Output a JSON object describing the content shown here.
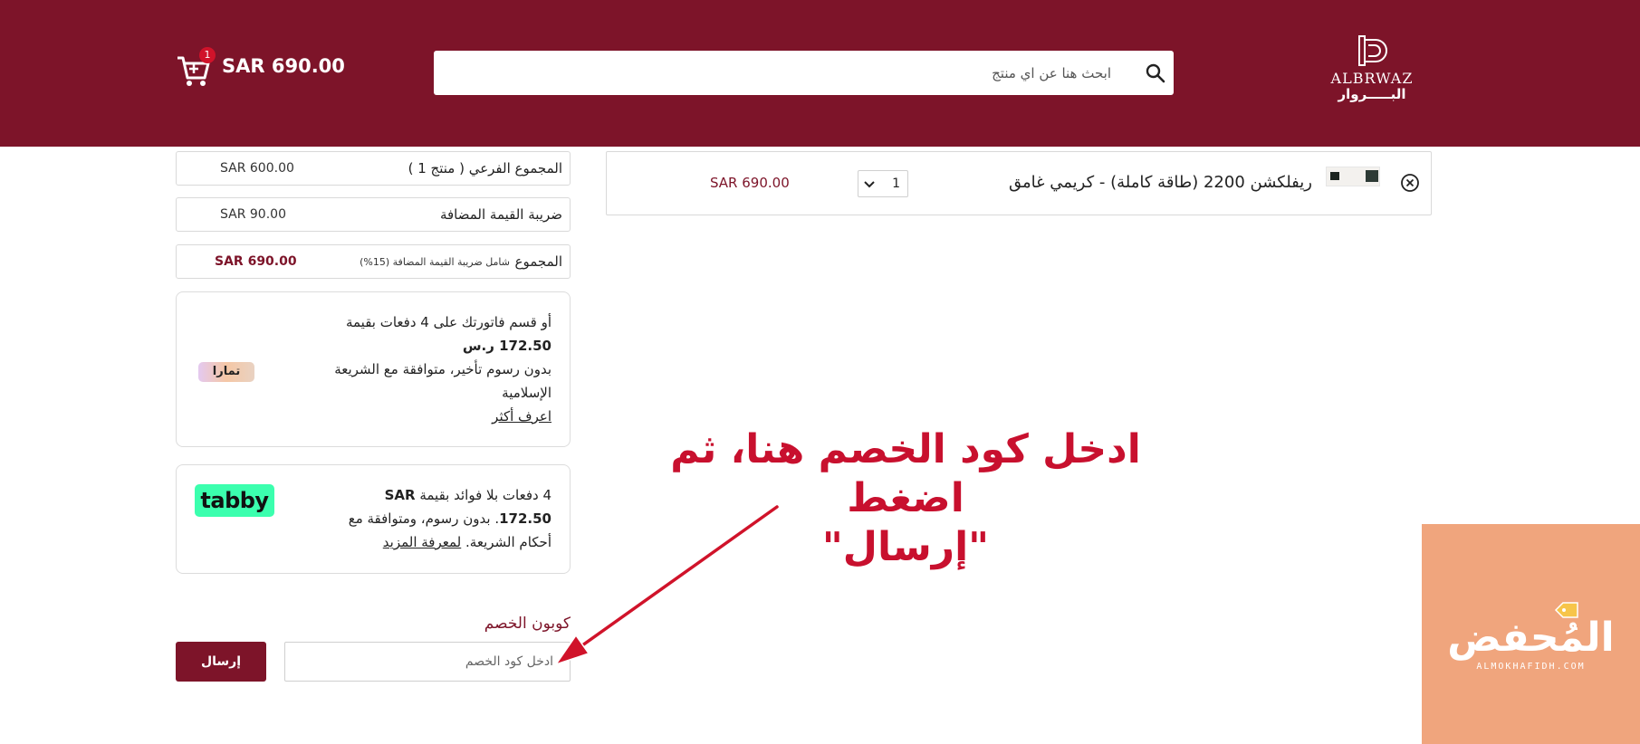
{
  "colors": {
    "brand": "#7d1429",
    "accent_red": "#c8102e",
    "tabby_green": "#3bffae",
    "watermark_bg": "#f0a57d"
  },
  "header": {
    "logo_en": "ALBRWAZ",
    "logo_ar": "البـــــروار",
    "search_placeholder": "ابحث هنا عن اي منتج",
    "cart_total": "SAR 690.00",
    "cart_count": "1",
    "icons": [
      "search-icon",
      "cart-icon"
    ]
  },
  "summary": {
    "subtotal_label": "المجموع الفرعي ( منتج 1 )",
    "subtotal_value": "SAR 600.00",
    "vat_label": "ضريبة القيمة المضافة",
    "vat_value": "SAR 90.00",
    "total_label": "المجموع",
    "total_note": "شامل ضريبة القيمة المضافة (15%)",
    "total_value": "SAR 690.00"
  },
  "tamara": {
    "line1": "أو قسم فاتورتك على 4 دفعات بقيمة",
    "amount": "172.50 ر.س",
    "line2": "بدون رسوم تأخير، متوافقة مع الشريعة الإسلامية",
    "learn_more": "اعرف أكثر",
    "logo": "تمارا"
  },
  "tabby": {
    "line1": "4 دفعات بلا فوائد بقيمة",
    "amount": "SAR 172.50",
    "line2": "بدون رسوم، ومتوافقة مع أحكام الشريعة.",
    "learn_more": "لمعرفة المزيد",
    "logo": "tabby"
  },
  "coupon": {
    "title": "كوبون الخصم",
    "placeholder": "ادخل كود الخصم",
    "submit_label": "إرسال"
  },
  "product": {
    "name": "ريفلكشن 2200 (طاقة كاملة) - كريمي غامق",
    "quantity": "1",
    "price": "SAR 690.00"
  },
  "annotation": {
    "line1": "ادخل كود الخصم هنا، ثم اضغط",
    "line2": "\"إرسال\""
  },
  "watermark": {
    "text": "المُحفض",
    "sub": "ALMOKHAFIDH.COM"
  }
}
